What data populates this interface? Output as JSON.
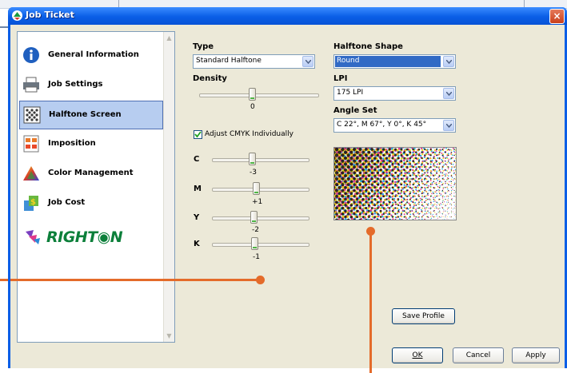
{
  "window": {
    "title": "Job Ticket",
    "close_glyph": "×"
  },
  "nav": {
    "items": [
      {
        "label": "General Information",
        "icon": "info-icon"
      },
      {
        "label": "Job Settings",
        "icon": "printer-icon"
      },
      {
        "label": "Halftone Screen",
        "icon": "halftone-icon",
        "selected": true
      },
      {
        "label": "Imposition",
        "icon": "imposition-icon"
      },
      {
        "label": "Color Management",
        "icon": "color-triangle-icon"
      },
      {
        "label": "Job Cost",
        "icon": "money-icon"
      }
    ],
    "logo_text": "RIGHT◉N"
  },
  "settings": {
    "type_label": "Type",
    "type_value": "Standard Halftone",
    "density_label": "Density",
    "density_value": "0",
    "adjust_label": "Adjust CMYK Individually",
    "adjust_checked": true,
    "channels": [
      {
        "name": "C",
        "value": "-3"
      },
      {
        "name": "M",
        "value": "+1"
      },
      {
        "name": "Y",
        "value": "-2"
      },
      {
        "name": "K",
        "value": "-1"
      }
    ],
    "shape_label": "Halftone Shape",
    "shape_value": "Round",
    "lpi_label": "LPI",
    "lpi_value": "175 LPI",
    "angle_label": "Angle Set",
    "angle_value": "C 22°, M 67°, Y 0°, K 45°",
    "save_profile": "Save Profile"
  },
  "buttons": {
    "ok": "OK",
    "cancel": "Cancel",
    "apply": "Apply"
  },
  "colors": {
    "accent": "#e46b2a",
    "titlebar": "#0a5ee6",
    "selection": "#316ac5"
  }
}
